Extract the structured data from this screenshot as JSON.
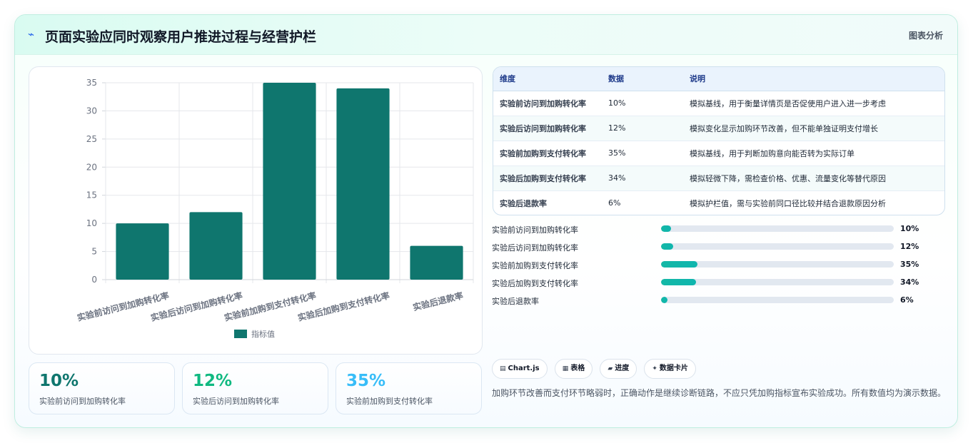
{
  "header": {
    "title_icon": "trend-icon",
    "title": "页面实验应同时观察用户推进过程与经营护栏",
    "tag": "图表分析"
  },
  "chart_data": {
    "type": "bar",
    "categories": [
      "实验前访问到加购转化率",
      "实验后访问到加购转化率",
      "实验前加购到支付转化率",
      "实验后加购到支付转化率",
      "实验后退款率"
    ],
    "series": [
      {
        "name": "指标值",
        "values": [
          10,
          12,
          35,
          34,
          6
        ]
      }
    ],
    "ylim": [
      0,
      35
    ],
    "yticks": [
      0,
      5,
      10,
      15,
      20,
      25,
      30,
      35
    ],
    "grid": true,
    "legend": "bottom",
    "color": "#0f766e"
  },
  "stats": [
    {
      "value": "10%",
      "label": "实验前访问到加购转化率",
      "color": "#0f766e"
    },
    {
      "value": "12%",
      "label": "实验后访问到加购转化率",
      "color": "#10b981"
    },
    {
      "value": "35%",
      "label": "实验前加购到支付转化率",
      "color": "#38bdf8"
    }
  ],
  "table": {
    "headers": [
      "维度",
      "数据",
      "说明"
    ],
    "rows": [
      [
        "实验前访问到加购转化率",
        "10%",
        "模拟基线，用于衡量详情页是否促使用户进入进一步考虑"
      ],
      [
        "实验后访问到加购转化率",
        "12%",
        "模拟变化显示加购环节改善，但不能单独证明支付增长"
      ],
      [
        "实验前加购到支付转化率",
        "35%",
        "模拟基线，用于判断加购意向能否转为实际订单"
      ],
      [
        "实验后加购到支付转化率",
        "34%",
        "模拟轻微下降，需检查价格、优惠、流量变化等替代原因"
      ],
      [
        "实验后退款率",
        "6%",
        "模拟护栏值，需与实验前同口径比较并结合退款原因分析"
      ]
    ]
  },
  "progress": [
    {
      "label": "实验前访问到加购转化率",
      "value": 10,
      "text": "10%"
    },
    {
      "label": "实验后访问到加购转化率",
      "value": 12,
      "text": "12%"
    },
    {
      "label": "实验前加购到支付转化率",
      "value": 35,
      "text": "35%"
    },
    {
      "label": "实验后加购到支付转化率",
      "value": 34,
      "text": "34%"
    },
    {
      "label": "实验后退款率",
      "value": 6,
      "text": "6%"
    }
  ],
  "progress_max": 225,
  "chips": [
    {
      "icon": "chart-icon",
      "glyph": "▤",
      "label": "Chart.js"
    },
    {
      "icon": "table-icon",
      "glyph": "▦",
      "label": "表格"
    },
    {
      "icon": "progress-icon",
      "glyph": "▰",
      "label": "进度"
    },
    {
      "icon": "sparkle-icon",
      "glyph": "✦",
      "label": "数据卡片"
    }
  ],
  "note": "加购环节改善而支付环节略弱时，正确动作是继续诊断链路，不应只凭加购指标宣布实验成功。所有数值均为演示数据。"
}
